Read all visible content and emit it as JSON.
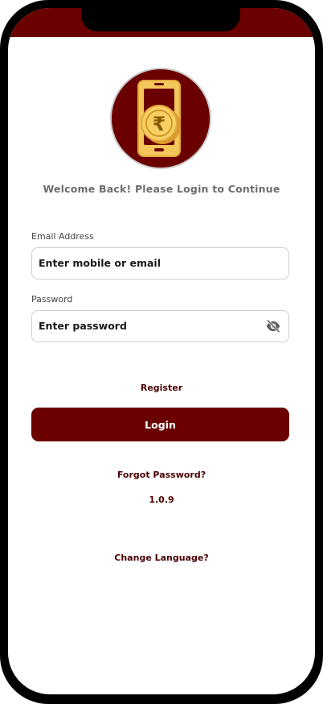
{
  "colors": {
    "brand": "#6b0000",
    "brand_text": "#4a0000",
    "coin_gold": "#f5c75a",
    "muted_text": "#6d6d6d"
  },
  "logo": {
    "symbol": "₹",
    "icon": "phone-rupee-coin-icon"
  },
  "welcome_text": "Welcome Back! Please Login to Continue",
  "form": {
    "email": {
      "label": "Email Address",
      "placeholder": "Enter mobile or email",
      "value": ""
    },
    "password": {
      "label": "Password",
      "placeholder": "Enter password",
      "value": "",
      "toggle_icon": "eye-off-icon"
    }
  },
  "links": {
    "register": "Register",
    "login_button": "Login",
    "forgot_password": "Forgot Password?",
    "change_language": "Change Language?"
  },
  "version": "1.0.9"
}
